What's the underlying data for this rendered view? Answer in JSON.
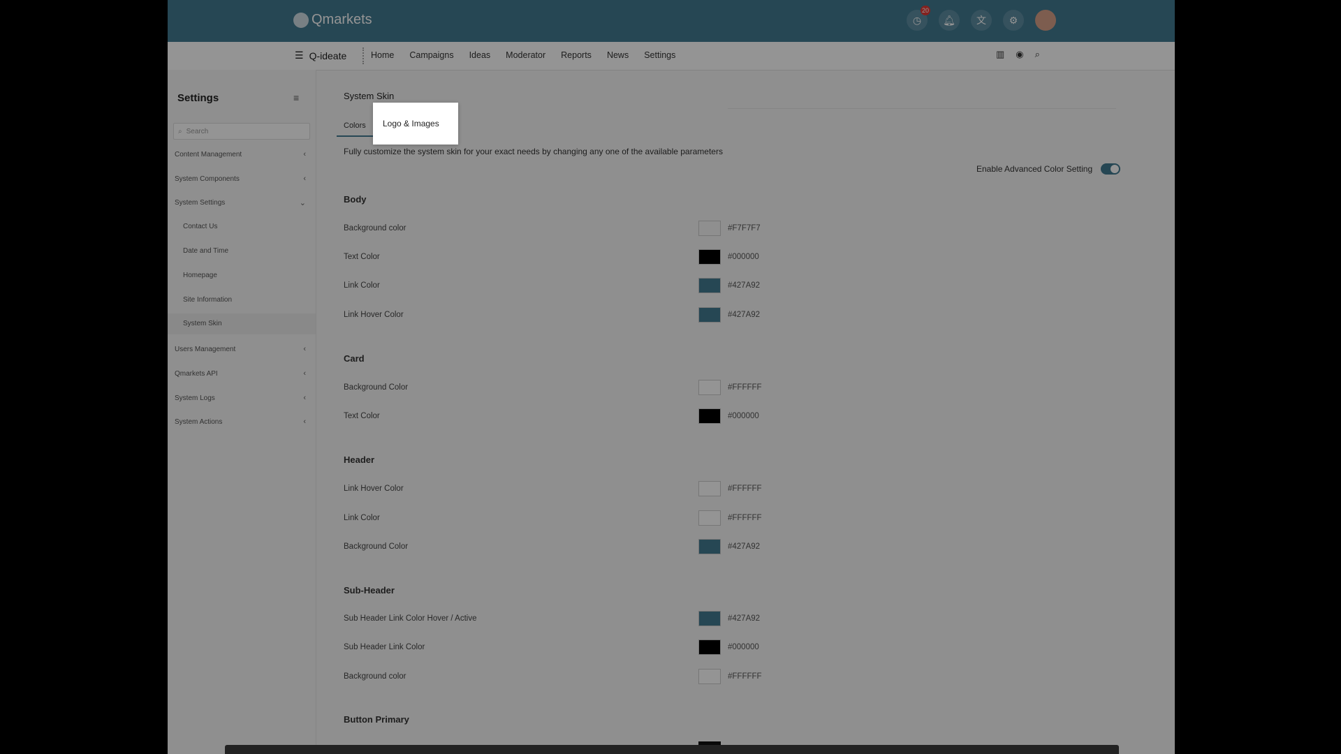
{
  "app": {
    "logo_text": "Qmarkets",
    "badge_count": "20"
  },
  "topbar": {
    "icons": [
      "clock-icon",
      "bell-icon",
      "translate-icon",
      "gear-icon"
    ]
  },
  "subheader": {
    "brand": "Q-ideate",
    "nav": [
      "Home",
      "Campaigns",
      "Ideas",
      "Moderator",
      "Reports",
      "News",
      "Settings"
    ]
  },
  "sidebar": {
    "title": "Settings",
    "search_placeholder": "Search",
    "items": [
      {
        "label": "Content Management"
      },
      {
        "label": "System Components"
      },
      {
        "label": "System Settings"
      },
      {
        "label": "Users Management"
      },
      {
        "label": "Qmarkets API"
      },
      {
        "label": "System Logs"
      },
      {
        "label": "System Actions"
      }
    ],
    "subitems": [
      "Contact Us",
      "Date and Time",
      "Homepage",
      "Site Information",
      "System Skin"
    ]
  },
  "main": {
    "page_title": "System Skin",
    "tabs": {
      "colors": "Colors",
      "logo_images": "Logo & Images"
    },
    "description": "Fully customize the system skin for your exact needs by changing any one of the available parameters",
    "advanced_label": "Enable Advanced Color Setting",
    "advanced_enabled": true,
    "sections": [
      {
        "title": "Body",
        "rows": [
          {
            "label": "Background color",
            "hex": "#F7F7F7",
            "color": "#f7f7f7"
          },
          {
            "label": "Text Color",
            "hex": "#000000",
            "color": "#000000"
          },
          {
            "label": "Link Color",
            "hex": "#427A92",
            "color": "#427a92"
          },
          {
            "label": "Link Hover Color",
            "hex": "#427A92",
            "color": "#427a92"
          }
        ]
      },
      {
        "title": "Card",
        "rows": [
          {
            "label": "Background Color",
            "hex": "#FFFFFF",
            "color": "#ffffff"
          },
          {
            "label": "Text Color",
            "hex": "#000000",
            "color": "#000000"
          }
        ]
      },
      {
        "title": "Header",
        "rows": [
          {
            "label": "Link Hover Color",
            "hex": "#FFFFFF",
            "color": "#ffffff"
          },
          {
            "label": "Link Color",
            "hex": "#FFFFFF",
            "color": "#ffffff"
          },
          {
            "label": "Background Color",
            "hex": "#427A92",
            "color": "#427a92"
          }
        ]
      },
      {
        "title": "Sub-Header",
        "rows": [
          {
            "label": "Sub Header Link Color Hover / Active",
            "hex": "#427A92",
            "color": "#427a92"
          },
          {
            "label": "Sub Header Link Color",
            "hex": "#000000",
            "color": "#000000"
          },
          {
            "label": "Background color",
            "hex": "#FFFFFF",
            "color": "#ffffff"
          }
        ]
      },
      {
        "title": "Button Primary",
        "rows": []
      }
    ]
  },
  "colors": {
    "accent": "#427a92",
    "background": "#f7f7f7"
  }
}
